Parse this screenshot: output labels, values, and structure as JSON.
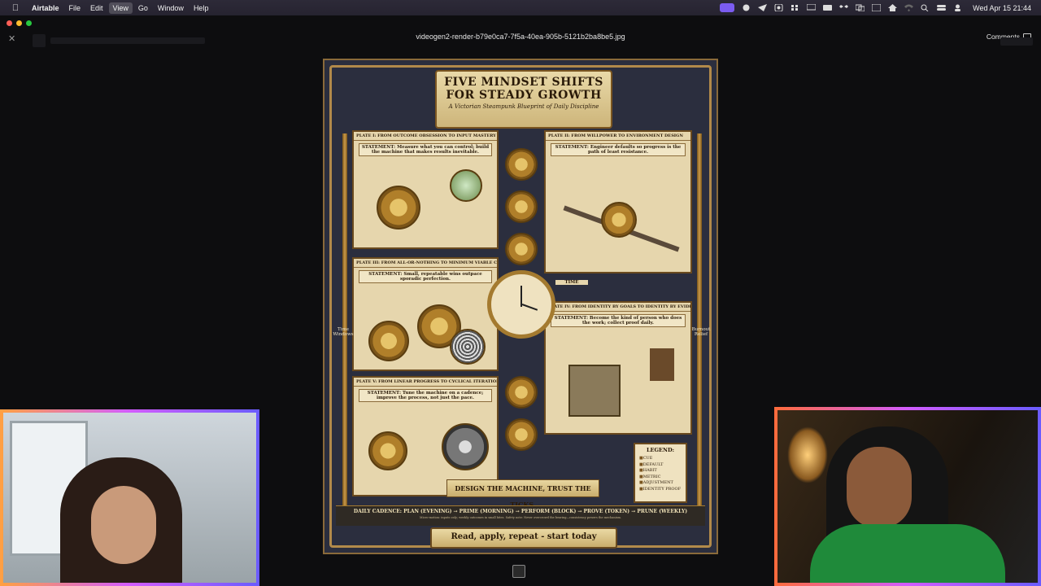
{
  "menubar": {
    "app": "Airtable",
    "items": [
      "File",
      "Edit",
      "View",
      "Go",
      "Window",
      "Help"
    ],
    "active_item": "View",
    "datetime": "Wed Apr 15  21:44"
  },
  "viewer": {
    "filename": "videogen2-render-b79e0ca7-7f5a-40ea-905b-5121b2ba8be5.jpg",
    "comments_label": "Comments"
  },
  "poster": {
    "title": "FIVE MINDSET SHIFTS FOR STEADY GROWTH",
    "subtitle": "A Victorian Steampunk Blueprint of Daily Discipline",
    "plates": [
      {
        "header": "PLATE I: FROM OUTCOME OBSESSION TO INPUT MASTERY",
        "statement": "STATEMENT: Measure what you can control; build the machine that makes results inevitable."
      },
      {
        "header": "PLATE II: FROM WILLPOWER TO ENVIRONMENT DESIGN",
        "statement": "STATEMENT: Engineer defaults so progress is the path of least resistance."
      },
      {
        "header": "PLATE III: FROM ALL-OR-NOTHING TO MINIMUM VIABLE CONSISTENCY",
        "statement": "STATEMENT: Small, repeatable wins outpace sporadic perfection."
      },
      {
        "header": "PLATE IV: FROM IDENTITY BY GOALS TO IDENTITY BY EVIDENCE",
        "statement": "STATEMENT: Become the kind of person who does the work; collect proof daily."
      },
      {
        "header": "PLATE V: FROM LINEAR PROGRESS TO CYCLICAL ITERATION",
        "statement": "STATEMENT: Tune the machine on a cadence; improve the process, not just the pace."
      }
    ],
    "side_left": "Time Windows",
    "side_right": "Burnout Relief",
    "ribbon": "DESIGN THE MACHINE, TRUST THE TICKS.",
    "cadence": "DAILY CADENCE: PLAN (EVENING) → PRIME (MORNING) → PERFORM (BLOCK) → PROVE (TOKEN) → PRUNE (WEEKLY)",
    "cadence_note": "Micro-motion: inputs only; weekly outcomes in small bites.   Safety note: Never overcrowd the bearing—consistency powers the mechanism.",
    "footer": "Read, apply, repeat - start today",
    "legend_title": "LEGEND:",
    "legend_items": [
      "CUE",
      "DEFAULT",
      "HABIT",
      "METRIC",
      "ADJUSTMENT",
      "IDENTITY PROOF"
    ],
    "time_label": "TIME"
  },
  "colors": {
    "menubar_bg": "#262330",
    "accent_purple": "#7b5cf0",
    "poster_bg": "#2b2e3e",
    "parchment": "#e6d6ad",
    "brass": "#b28a4a"
  }
}
